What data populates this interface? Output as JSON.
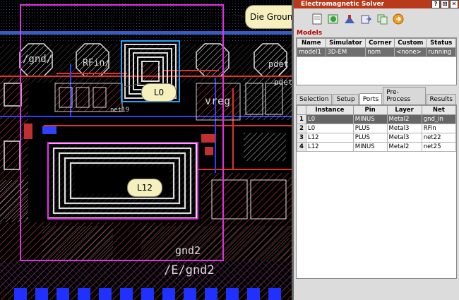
{
  "layout_view": {
    "callout": "Die Ground",
    "labels": {
      "gnd": "/gnd/",
      "rfin": "RFin/",
      "pdet": "pdet",
      "pdet2": "pdet",
      "vreg": "vreg",
      "net19": "net19",
      "l0": "L0",
      "l12": "L12",
      "gnd2": "gnd2",
      "egnd2": "/E/gnd2"
    }
  },
  "panel": {
    "title": "Electromagnetic Solver",
    "title_buttons": [
      "?",
      "⊞",
      "✕"
    ],
    "toolbar_icons": [
      "new-file-icon",
      "simulate-icon",
      "tools-icon",
      "export-icon",
      "copy-icon",
      "stop-icon"
    ],
    "models": {
      "label": "Models",
      "headers": [
        "Name",
        "Simulator",
        "Corner",
        "Custom",
        "Status"
      ],
      "rows": [
        [
          "model1",
          "3D-EM",
          "nom",
          "<none>",
          "running"
        ]
      ]
    },
    "tabs": [
      "Selection",
      "Setup",
      "Ports",
      "Pre-Process",
      "Results"
    ],
    "active_tab": "Ports",
    "ports": {
      "headers": [
        "Instance",
        "Pin",
        "Layer",
        "Net"
      ],
      "rows": [
        {
          "num": "1",
          "cells": [
            "L0",
            "MINUS",
            "Metal2",
            "gnd_in"
          ]
        },
        {
          "num": "2",
          "cells": [
            "L0",
            "PLUS",
            "Metal3",
            "RFin"
          ]
        },
        {
          "num": "3",
          "cells": [
            "L12",
            "PLUS",
            "Metal3",
            "net22"
          ]
        },
        {
          "num": "4",
          "cells": [
            "L12",
            "MINUS",
            "Metal2",
            "net25"
          ]
        }
      ]
    }
  }
}
